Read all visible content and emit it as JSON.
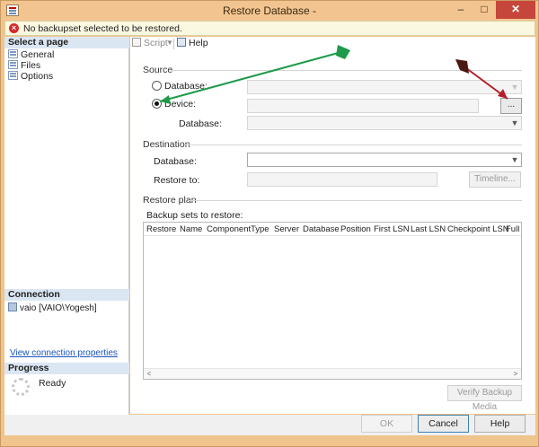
{
  "window": {
    "title": "Restore Database -",
    "minimize": "–",
    "maximize": "□",
    "close": "✕"
  },
  "message": {
    "icon": "error-icon",
    "text": "No backupset selected to be restored."
  },
  "left": {
    "select_page_header": "Select a page",
    "pages": [
      "General",
      "Files",
      "Options"
    ],
    "connection_header": "Connection",
    "connection_value": "vaio [VAIO\\Yogesh]",
    "view_connection_link": "View connection properties",
    "progress_header": "Progress",
    "progress_status": "Ready"
  },
  "toolbar": {
    "script_label": "Script",
    "dropdown_glyph": "▼",
    "help_label": "Help"
  },
  "source": {
    "header": "Source",
    "database_radio": "Database:",
    "device_radio": "Device:",
    "device_database_label": "Database:",
    "browse_label": "...",
    "selected": "device"
  },
  "destination": {
    "header": "Destination",
    "database_label": "Database:",
    "restore_to_label": "Restore to:",
    "timeline_label": "Timeline..."
  },
  "restore_plan": {
    "header": "Restore plan",
    "backup_sets_label": "Backup sets to restore:",
    "columns": [
      "Restore",
      "Name",
      "Component",
      "Type",
      "Server",
      "Database",
      "Position",
      "First LSN",
      "Last LSN",
      "Checkpoint LSN",
      "Full LSN"
    ],
    "scroll_left": "<",
    "scroll_right": ">",
    "verify_label": "Verify Backup Media"
  },
  "footer": {
    "ok_label": "OK",
    "cancel_label": "Cancel",
    "help_label": "Help"
  },
  "colors": {
    "window_frame": "#f0c48d",
    "close_button": "#c7463c",
    "green_arrow": "#1e9a4a",
    "red_arrow": "#b3202a"
  }
}
